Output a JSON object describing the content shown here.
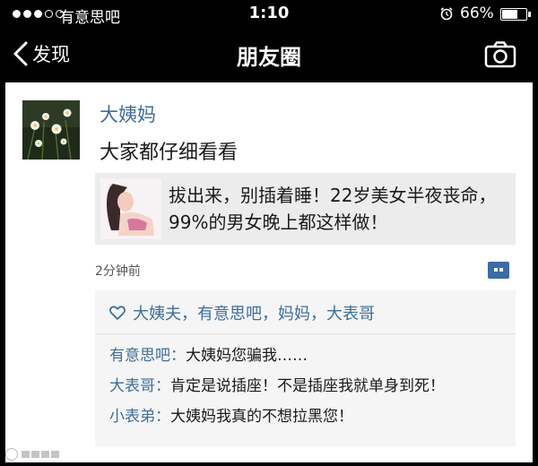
{
  "status_bar": {
    "carrier": "有意思吧",
    "time": "1:10",
    "battery_percent": "66%",
    "battery_level": 0.66,
    "signal_bars": 3,
    "signal_total": 5
  },
  "nav": {
    "back_label": "发现",
    "title": "朋友圈"
  },
  "post": {
    "author": "大姨妈",
    "text": "大家都仔细看看",
    "shared_link_title": "拔出来，别插着睡！22岁美女半夜丧命，99%的男女晚上都这样做！",
    "time": "2分钟前"
  },
  "likes": {
    "names": "大姨夫，有意思吧，妈妈，大表哥"
  },
  "comments": [
    {
      "author": "有意思吧：",
      "text": "大姨妈您骗我……"
    },
    {
      "author": "大表哥：",
      "text": "肯定是说插座！不是插座我就单身到死！"
    },
    {
      "author": "小表弟：",
      "text": "大姨妈我真的不想拉黑您！"
    }
  ],
  "colors": {
    "link_blue": "#3d6e9c",
    "accent_blue": "#3c6ca4",
    "bar_black": "#000000"
  },
  "icons": [
    "back-chevron-icon",
    "camera-icon",
    "alarm-icon",
    "heart-outline-icon",
    "comment-icon"
  ]
}
